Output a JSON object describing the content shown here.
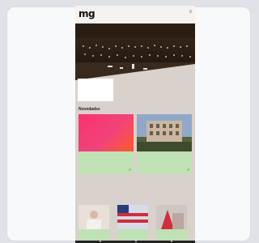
{
  "header": {
    "logo": "mg",
    "logo_sub": "",
    "menu_icon": "menu-icon"
  },
  "hero": {
    "title": "",
    "more": ""
  },
  "news": {
    "heading": "Novedades",
    "items": [
      {
        "image_text": "",
        "title": "",
        "more": "",
        "arrow_icon": "arrow-icon"
      },
      {
        "title": "",
        "more": "",
        "arrow_icon": "arrow-icon"
      }
    ]
  },
  "featured": {
    "heading": "",
    "tiles": [
      {
        "text": ""
      },
      {
        "text": ""
      },
      {
        "text": ""
      }
    ]
  },
  "colors": {
    "accent_red": "#e12b2b",
    "news_bg": "#bfe1b4",
    "page_bg": "#d9d1cc"
  }
}
